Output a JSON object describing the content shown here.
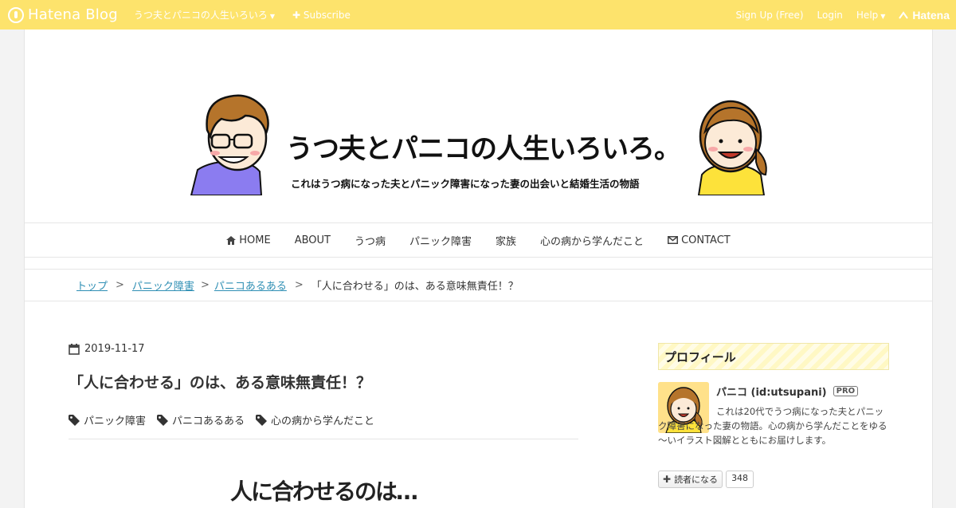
{
  "topbar": {
    "logo_text": "Hatena Blog",
    "blog_name": "うつ夫とパニコの人生いろいろ",
    "subscribe": "Subscribe",
    "signup": "Sign Up (Free)",
    "login": "Login",
    "help": "Help",
    "hatena": "Hatena"
  },
  "header": {
    "title": "うつ夫とパニコの人生いろいろ。",
    "subtitle": "これはうつ病になった夫とパニック障害になった妻の出会いと結婚生活の物語"
  },
  "nav": {
    "items": [
      {
        "label": "HOME",
        "icon": "home-icon"
      },
      {
        "label": "ABOUT"
      },
      {
        "label": "うつ病"
      },
      {
        "label": "パニック障害"
      },
      {
        "label": "家族"
      },
      {
        "label": "心の病から学んだこと"
      },
      {
        "label": "CONTACT",
        "icon": "envelope-icon"
      }
    ]
  },
  "breadcrumb": {
    "items": [
      "トップ",
      "パニック障害",
      "パニコあるある"
    ],
    "separator": ">",
    "current": "「人に合わせる」のは、ある意味無責任！？"
  },
  "article": {
    "date": "2019-11-17",
    "title": "「人に合わせる」のは、ある意味無責任！？",
    "categories": [
      "パニック障害",
      "パニコあるある",
      "心の病から学んだこと"
    ],
    "image_text": "人に合わせるのは…"
  },
  "sidebar": {
    "heading": "プロフィール",
    "name": "パニコ (id:utsupani)",
    "badge": "PRO",
    "description": "これは20代でうつ病になった夫とパニック障害になった妻の物語。心の病から学んだことをゆる～いイラスト図解とともにお届けします。",
    "reader_button": "読者になる",
    "reader_count": "348"
  },
  "colors": {
    "topbar": "#fde36c",
    "link": "#2f8fb4",
    "husband_shirt": "#8b7cf0",
    "wife_shirt": "#fde23a"
  }
}
